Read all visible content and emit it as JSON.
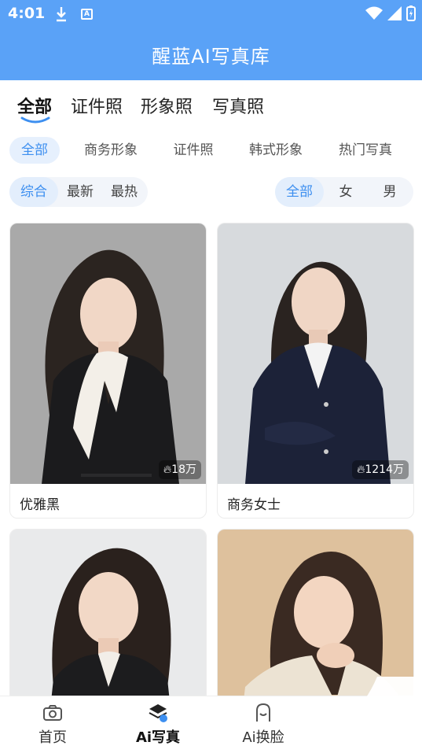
{
  "status": {
    "time": "4:01"
  },
  "header": {
    "title": "醒蓝AI写真库"
  },
  "categories": [
    {
      "label": "全部",
      "active": true
    },
    {
      "label": "证件照",
      "active": false
    },
    {
      "label": "形象照",
      "active": false
    },
    {
      "label": "写真照",
      "active": false
    }
  ],
  "styles": [
    {
      "label": "全部",
      "active": true
    },
    {
      "label": "商务形象",
      "active": false
    },
    {
      "label": "证件照",
      "active": false
    },
    {
      "label": "韩式形象",
      "active": false
    },
    {
      "label": "热门写真",
      "active": false
    }
  ],
  "sort": [
    {
      "label": "综合",
      "active": true
    },
    {
      "label": "最新",
      "active": false
    },
    {
      "label": "最热",
      "active": false
    }
  ],
  "gender": [
    {
      "label": "全部",
      "active": true
    },
    {
      "label": "女",
      "active": false
    },
    {
      "label": "男",
      "active": false
    }
  ],
  "cards": [
    {
      "title": "优雅黑",
      "views": "18万"
    },
    {
      "title": "商务女士",
      "views": "1214万"
    },
    {
      "title": "",
      "views": ""
    },
    {
      "title": "",
      "views": ""
    }
  ],
  "nav": [
    {
      "label": "首页",
      "icon": "camera-icon",
      "active": false
    },
    {
      "label": "Ai写真",
      "icon": "layers-icon",
      "active": true
    },
    {
      "label": "Ai换脸",
      "icon": "face-icon",
      "active": false
    }
  ],
  "colors": {
    "accent": "#5aa2f7",
    "active_text": "#3d8ff0"
  }
}
